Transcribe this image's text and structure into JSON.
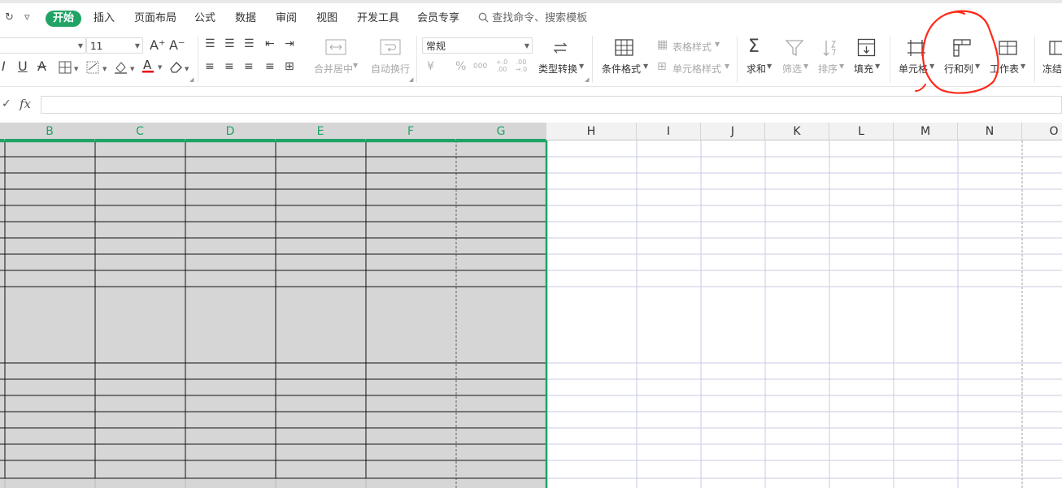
{
  "quick_access": {
    "redo": "↻",
    "dropdown": "▿"
  },
  "tabs": [
    {
      "label": "开始",
      "active": true
    },
    {
      "label": "插入"
    },
    {
      "label": "页面布局"
    },
    {
      "label": "公式"
    },
    {
      "label": "数据"
    },
    {
      "label": "审阅"
    },
    {
      "label": "视图"
    },
    {
      "label": "开发工具"
    },
    {
      "label": "会员专享"
    }
  ],
  "search": {
    "label": "查找命令、搜索模板"
  },
  "ribbon": {
    "font_size": "11",
    "number_format": "常规",
    "merge_label": "合并居中",
    "wrap_label": "自动换行",
    "type_convert_label": "类型转换",
    "cond_format_label": "条件格式",
    "table_style_label": "表格样式",
    "cell_style_label": "单元格样式",
    "sum_label": "求和",
    "filter_label": "筛选",
    "sort_label": "排序",
    "fill_label": "填充",
    "cell_label": "单元格",
    "rowcol_label": "行和列",
    "sheet_label": "工作表",
    "freeze_label": "冻结",
    "currency": "¥",
    "percent": "%",
    "thousands": "000",
    "inc_dec": "+.0 .00",
    "dec_dec": ".00 →.0",
    "font_color": "#e60012",
    "annotation_color": "#ff2a1a"
  },
  "formula_bar": {
    "check": "✓",
    "fx": "fx",
    "value": ""
  },
  "columns": {
    "selected": [
      "B",
      "C",
      "D",
      "E",
      "F",
      "G"
    ],
    "other": [
      "H",
      "I",
      "J",
      "K",
      "L",
      "M",
      "N",
      "O"
    ]
  },
  "colors": {
    "accent": "#21a366",
    "selected_fill": "#d6d6d6",
    "grid_line": "#c9cbe3"
  }
}
